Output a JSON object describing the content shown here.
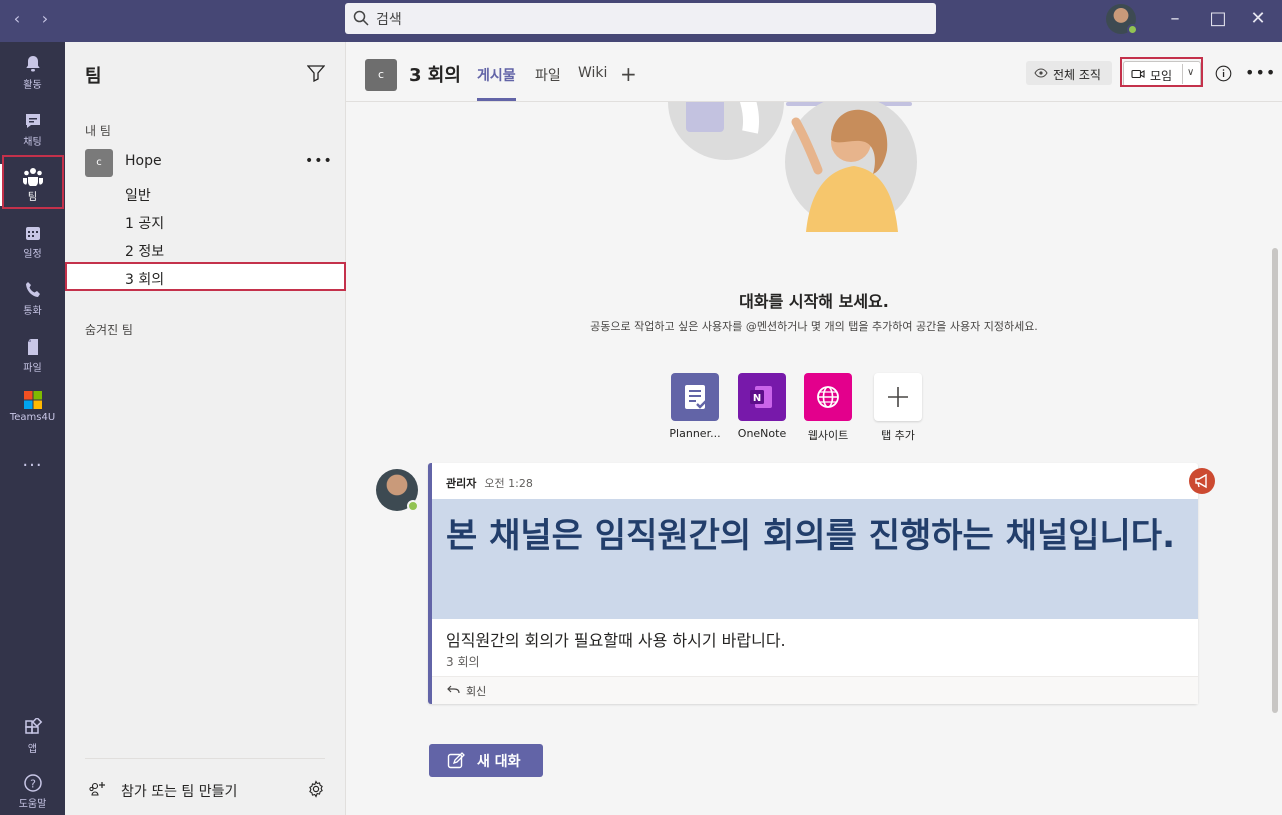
{
  "titlebar": {
    "search_placeholder": "검색"
  },
  "rail": {
    "items": [
      {
        "label": "활동",
        "icon": "bell-icon"
      },
      {
        "label": "채팅",
        "icon": "chat-icon"
      },
      {
        "label": "팀",
        "icon": "teams-icon"
      },
      {
        "label": "일정",
        "icon": "calendar-icon"
      },
      {
        "label": "통화",
        "icon": "phone-icon"
      },
      {
        "label": "파일",
        "icon": "file-icon"
      },
      {
        "label": "Teams4U",
        "icon": "teams4u-app-icon"
      },
      {
        "label": "...",
        "icon": "more-apps-icon"
      }
    ],
    "bottom": [
      {
        "label": "앱",
        "icon": "apps-icon"
      },
      {
        "label": "도움말",
        "icon": "help-icon"
      }
    ]
  },
  "teams_panel": {
    "title": "팀",
    "my_teams_label": "내 팀",
    "team": {
      "avatar_letter": "c",
      "name": "Hope",
      "channels": [
        "일반",
        "1 공지",
        "2 정보",
        "3 회의"
      ]
    },
    "hidden_teams_label": "숨겨진 팀",
    "join_label": "참가 또는 팀 만들기"
  },
  "channel_header": {
    "avatar_letter": "c",
    "title": "3 회의",
    "tabs": [
      "게시물",
      "파일",
      "Wiki"
    ],
    "org_label": "전체 조직",
    "meet_label": "모임"
  },
  "posts": {
    "empty_title": "대화를 시작해 보세요.",
    "empty_subtitle": "공동으로 작업하고 싶은 사용자를 @멘션하거나 몇 개의 탭을 추가하여 공간을 사용자 지정하세요.",
    "apps": [
      {
        "label": "Planner...",
        "color": "#6264a7"
      },
      {
        "label": "OneNote",
        "color": "#7719aa"
      },
      {
        "label": "웹사이트",
        "color": "#e3008c"
      },
      {
        "label": "탭 추가",
        "color": "#ffffff"
      }
    ],
    "post": {
      "author": "관리자",
      "time": "오전 1:28",
      "headline": "본 채널은 임직원간의 회의를 진행하는 채널입니다.",
      "subtitle": "임직원간의 회의가 필요할때 사용 하시기 바랍니다.",
      "channel": "3 회의",
      "reply_label": "회신"
    },
    "new_conversation_label": "새 대화"
  },
  "colors": {
    "titlebar": "#464775",
    "rail": "#33344a",
    "accent": "#6264a7",
    "highlight_box": "#c4314b",
    "headline_band": "#ccd8ea",
    "headline_text": "#223e6b"
  }
}
